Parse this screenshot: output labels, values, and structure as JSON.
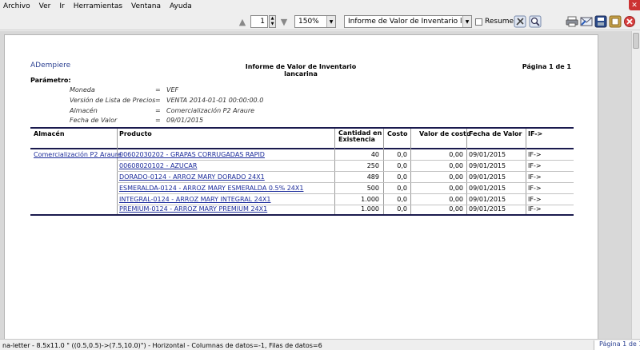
{
  "menu": [
    "Archivo",
    "Ver",
    "Ir",
    "Herramientas",
    "Ventana",
    "Ayuda"
  ],
  "toolbar": {
    "page_value": "1",
    "zoom_value": "150%",
    "report_value": "Informe de Valor de Inventario lancarina",
    "summary_label": "Resumen"
  },
  "report": {
    "logo": "ADempiere",
    "title": "Informe de Valor de Inventario lancarina",
    "page_info": "Página 1 de 1",
    "params_heading": "Parámetro:",
    "params": [
      {
        "name": "Moneda",
        "eq": "=",
        "value": "VEF"
      },
      {
        "name": "Versión de Lista de Precios",
        "eq": "=",
        "value": "VENTA 2014-01-01 00:00:00.0"
      },
      {
        "name": "Almacén",
        "eq": "=",
        "value": "Comercialización P2 Araure"
      },
      {
        "name": "Fecha de Valor",
        "eq": "=",
        "value": "09/01/2015"
      }
    ],
    "columns": {
      "warehouse": "Almacén",
      "product": "Producto",
      "qty_line1": "Cantidad en",
      "qty_line2": "Existencia",
      "cost": "Costo",
      "cost_value": "Valor de costo",
      "value_date": "Fecha de Valor",
      "if": "IF->"
    },
    "rows": [
      {
        "warehouse": "Comercialización P2 Araure",
        "product": "00602030202 - GRAPAS CORRUGADAS RAPID",
        "qty": "40",
        "cost": "0,0",
        "cost_value": "0,00",
        "date": "09/01/2015",
        "if": "IF->"
      },
      {
        "warehouse": "",
        "product": "00608020102 - AZUCAR",
        "qty": "250",
        "cost": "0,0",
        "cost_value": "0,00",
        "date": "09/01/2015",
        "if": "IF->"
      },
      {
        "warehouse": "",
        "product": "DORADO-0124 - ARROZ MARY DORADO 24X1",
        "qty": "489",
        "cost": "0,0",
        "cost_value": "0,00",
        "date": "09/01/2015",
        "if": "IF->"
      },
      {
        "warehouse": "",
        "product": "ESMERALDA-0124 - ARROZ MARY ESMERALDA 0.5% 24X1",
        "qty": "500",
        "cost": "0,0",
        "cost_value": "0,00",
        "date": "09/01/2015",
        "if": "IF->"
      },
      {
        "warehouse": "",
        "product": "INTEGRAL-0124 - ARROZ MARY INTEGRAL 24X1",
        "qty": "1.000",
        "cost": "0,0",
        "cost_value": "0,00",
        "date": "09/01/2015",
        "if": "IF->"
      },
      {
        "warehouse": "",
        "product": "PREMIUM-0124 - ARROZ MARY PREMIUM 24X1",
        "qty": "1.000",
        "cost": "0,0",
        "cost_value": "0,00",
        "date": "09/01/2015",
        "if": "IF->"
      }
    ]
  },
  "status": {
    "text": "na-letter - 8.5x11.0 \" ((0.5,0.5)->(7.5,10.0)\") - Horizontal - Columnas de datos=-1, Filas de datos=6",
    "page": "Página 1 de 1"
  }
}
